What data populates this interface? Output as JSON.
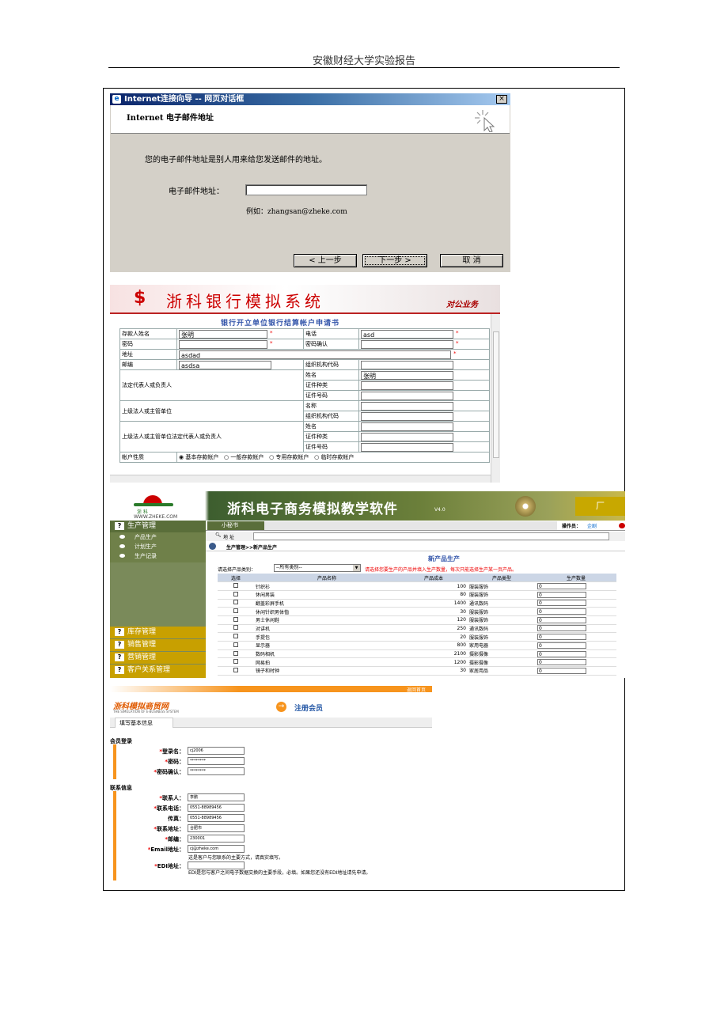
{
  "header": {
    "title": "安徽财经大学实验报告"
  },
  "dialog": {
    "title": "Internet连接向导 -- 网页对话框",
    "heading": "Internet 电子邮件地址",
    "description": "您的电子邮件地址是别人用来给您发送邮件的地址。",
    "email_label": "电子邮件地址：",
    "email_value": "",
    "example": "例如：zhangsan@zheke.com",
    "back_label": "< 上一步",
    "next_label": "下一步 >",
    "cancel_label": "取  消",
    "close_glyph": "×"
  },
  "bank": {
    "logo": "$",
    "title": "浙科银行模拟系统",
    "subtitle": "对公业务",
    "form_title": "银行开立单位银行结算帐户申请书",
    "name_label": "存款人姓名",
    "name_value": "张明",
    "phone_label": "电话",
    "phone_value": "asd",
    "password_label": "密码",
    "password_confirm_label": "密码确认",
    "address_label": "地址",
    "address_value": "asdad",
    "postcode_label": "邮编",
    "postcode_value": "asdsa",
    "org_code_label": "组织机构代码",
    "legal_rep_label": "法定代表人或负责人",
    "surname_label": "姓名",
    "legal_name_value": "张明",
    "id_type_label": "证件种类",
    "id_number_label": "证件号码",
    "superior_label": "上级法人或主管单位",
    "org_name_label": "名称",
    "superior_rep_label": "上级法人或主管单位法定代表人或负责人",
    "account_type_label": "帐户性质",
    "account_types": [
      "基本存款帐户",
      "一般存款帐户",
      "专用存款帐户",
      "临时存款帐户"
    ]
  },
  "ecom": {
    "site": "WWW.ZHEKE.COM",
    "logo_text": "浙   科",
    "title": "浙科电子商务模拟教学软件",
    "version": "V4.0",
    "right_tab": "厂",
    "secretary": "小秘书",
    "operator_label": "操作员：",
    "operator_value": "企剧",
    "address_label": "地 址",
    "breadcrumb": "生产管理>>新产品生产",
    "section_title": "新产品生产",
    "category_label": "请选择产品类别：",
    "category_value": "--所有类别--",
    "instruction": "请选择您要生产的产品并填入生产数量，每次只能选择生产某一页产品。",
    "menu": [
      {
        "label": "生产管理",
        "items": [
          "产品生产",
          "计划生产",
          "生产记录"
        ]
      },
      {
        "label": "库存管理"
      },
      {
        "label": "销售管理"
      },
      {
        "label": "营销管理"
      },
      {
        "label": "客户关系管理"
      }
    ],
    "columns": [
      "选择",
      "产品名称",
      "产品成本",
      "产品类型",
      "生产数量"
    ],
    "products": [
      {
        "name": "针织衫",
        "cost": "100",
        "type": "服装服饰",
        "qty": "0"
      },
      {
        "name": "休闲男装",
        "cost": "80",
        "type": "服装服饰",
        "qty": "0"
      },
      {
        "name": "翻盖彩屏手机",
        "cost": "1400",
        "type": "通讯数码",
        "qty": "0"
      },
      {
        "name": "休闲针织男体恤",
        "cost": "30",
        "type": "服装服饰",
        "qty": "0"
      },
      {
        "name": "男士休闲鞋",
        "cost": "120",
        "type": "服装服饰",
        "qty": "0"
      },
      {
        "name": "对讲机",
        "cost": "250",
        "type": "通讯数码",
        "qty": "0"
      },
      {
        "name": "手提包",
        "cost": "20",
        "type": "服装服饰",
        "qty": "0"
      },
      {
        "name": "显示器",
        "cost": "800",
        "type": "家用电器",
        "qty": "0"
      },
      {
        "name": "数码相机",
        "cost": "2100",
        "type": "摄影摄像",
        "qty": "0"
      },
      {
        "name": "网易拍",
        "cost": "1200",
        "type": "摄影摄像",
        "qty": "0"
      },
      {
        "name": "镜子和时钟",
        "cost": "30",
        "type": "家居用品",
        "qty": "0"
      }
    ]
  },
  "register": {
    "top_right": "返回首页",
    "logo": "浙科模拟商贸网",
    "logo_sub": "THE SIMULATION OF E-BUSINESS SYSTEM",
    "title": "注册会员",
    "tab": "填写基本信息",
    "member_section": "会员登录",
    "login_label": "登录名：",
    "login_value": "cj2006",
    "password_label": "密码：",
    "password_value": "********",
    "confirm_label": "密码确认：",
    "confirm_value": "********",
    "contact_section": "联系信息",
    "contact_label": "联系人：",
    "contact_value": "李鹏",
    "phone_label": "联系电话：",
    "phone_value": "0551-88989456",
    "fax_label": "传真：",
    "fax_value": "0551-88989456",
    "address_label": "联系地址：",
    "address_value": "合肥市",
    "zip_label": "邮编：",
    "zip_value": "230001",
    "email_label": "Email地址：",
    "email_value": "cj@zheke.com",
    "email_note": "这是客户与您联系的主要方式，请真实填写。",
    "edi_label": "EDI地址：",
    "edi_value": "",
    "edi_note": "EDI是您与客户之间电子数据交换的主要手段，必填。如果您还没有EDI地址请先申请。"
  }
}
